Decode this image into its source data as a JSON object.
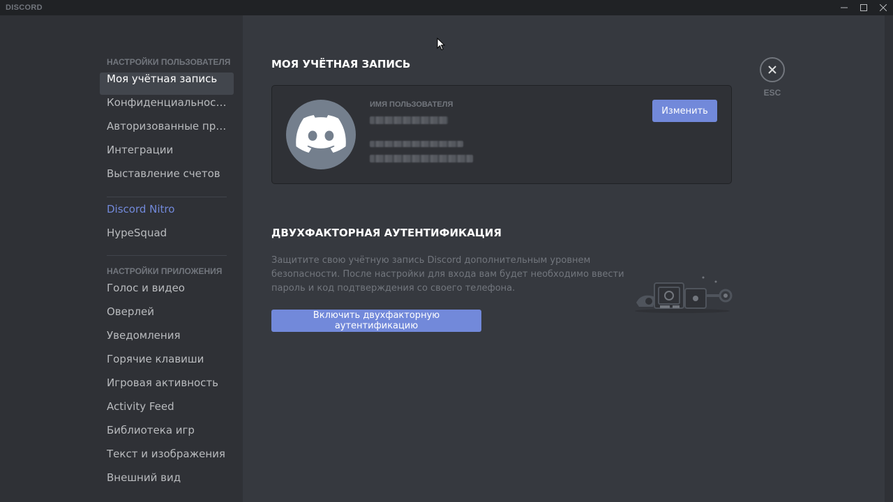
{
  "app": {
    "title": "DISCORD"
  },
  "window_controls": {
    "minimize": "minimize-icon",
    "maximize": "maximize-icon",
    "close": "close-icon"
  },
  "sidebar": {
    "user_settings_header": "НАСТРОЙКИ ПОЛЬЗОВАТЕЛЯ",
    "user_items": [
      {
        "label": "Моя учётная запись",
        "active": true
      },
      {
        "label": "Конфиденциальность"
      },
      {
        "label": "Авторизованные приложения"
      },
      {
        "label": "Интеграции"
      },
      {
        "label": "Выставление счетов"
      }
    ],
    "extra_items": [
      {
        "label": "Discord Nitro"
      },
      {
        "label": "HypeSquad"
      }
    ],
    "app_settings_header": "НАСТРОЙКИ ПРИЛОЖЕНИЯ",
    "app_items": [
      {
        "label": "Голос и видео"
      },
      {
        "label": "Оверлей"
      },
      {
        "label": "Уведомления"
      },
      {
        "label": "Горячие клавиши"
      },
      {
        "label": "Игровая активность"
      },
      {
        "label": "Activity Feed"
      },
      {
        "label": "Библиотека игр"
      },
      {
        "label": "Текст и изображения"
      },
      {
        "label": "Внешний вид"
      }
    ]
  },
  "account": {
    "title": "МОЯ УЧЁТНАЯ ЗАПИСЬ",
    "username_label": "ИМЯ ПОЛЬЗОВАТЕЛЯ",
    "edit_label": "Изменить"
  },
  "two_factor": {
    "title": "ДВУХФАКТОРНАЯ АУТЕНТИФИКАЦИЯ",
    "description": "Защитите свою учётную запись Discord дополнительным уровнем безопасности. После настройки для входа вам будет необходимо ввести пароль и код подтверждения со своего телефона.",
    "enable_label": "Включить двухфакторную аутентификацию"
  },
  "close": {
    "label": "ESC"
  },
  "colors": {
    "accent": "#7289da",
    "background": "#36393f",
    "sidebar": "#2f3136",
    "titlebar": "#202225"
  }
}
